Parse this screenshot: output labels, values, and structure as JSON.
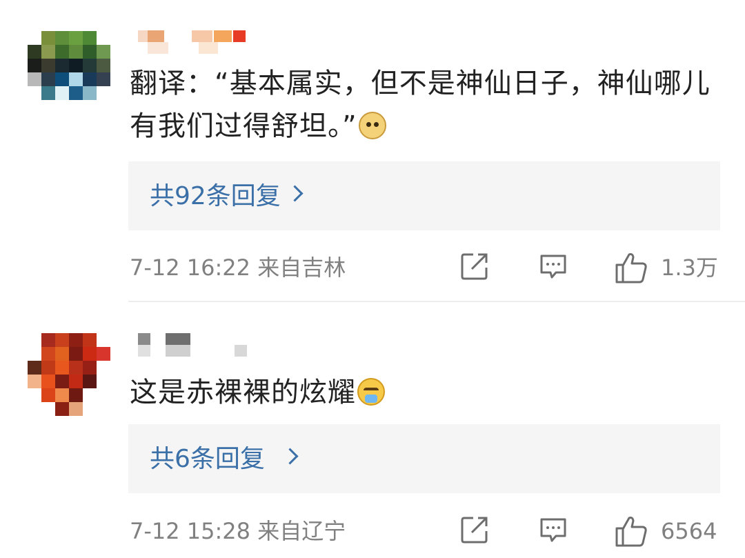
{
  "comments": [
    {
      "text": "翻译：“基本属实，但不是神仙日子，神仙哪儿有我们过得舒坦。”",
      "emoji": "doge-emoji",
      "replies_label": "共92条回复",
      "timestamp": "7-12 16:22",
      "location": "来自吉林",
      "like_count": "1.3万"
    },
    {
      "text": "这是赤裸裸的炫耀",
      "emoji": "crying-emoji",
      "replies_label": "共6条回复",
      "timestamp": "7-12 15:28",
      "location": "来自辽宁",
      "like_count": "6564"
    }
  ],
  "colors": {
    "link_blue": "#3a6fa8",
    "meta_gray": "#808080",
    "reply_bg": "#f5f5f5",
    "text": "#222222"
  }
}
